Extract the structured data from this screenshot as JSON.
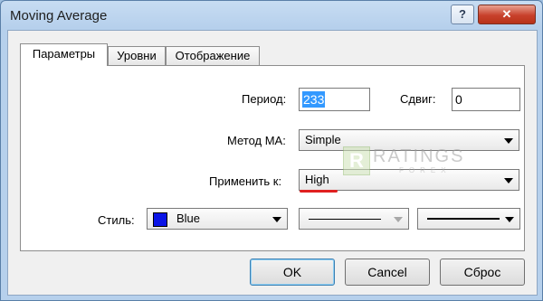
{
  "window": {
    "title": "Moving Average",
    "help_label": "?",
    "close_label": "✕"
  },
  "tabs": [
    {
      "label": "Параметры",
      "active": true
    },
    {
      "label": "Уровни",
      "active": false
    },
    {
      "label": "Отображение",
      "active": false
    }
  ],
  "params": {
    "period_label": "Период:",
    "period_value": "233",
    "shift_label": "Сдвиг:",
    "shift_value": "0",
    "method_label": "Метод МА:",
    "method_value": "Simple",
    "apply_label": "Применить к:",
    "apply_value": "High",
    "style_label": "Стиль:",
    "color_value": "Blue",
    "color_hex": "#0a14e6"
  },
  "watermark": {
    "text": "RATINGS",
    "sub": "FOREX",
    "mark": "R"
  },
  "buttons": {
    "ok": "OK",
    "cancel": "Cancel",
    "reset": "Сброс"
  }
}
